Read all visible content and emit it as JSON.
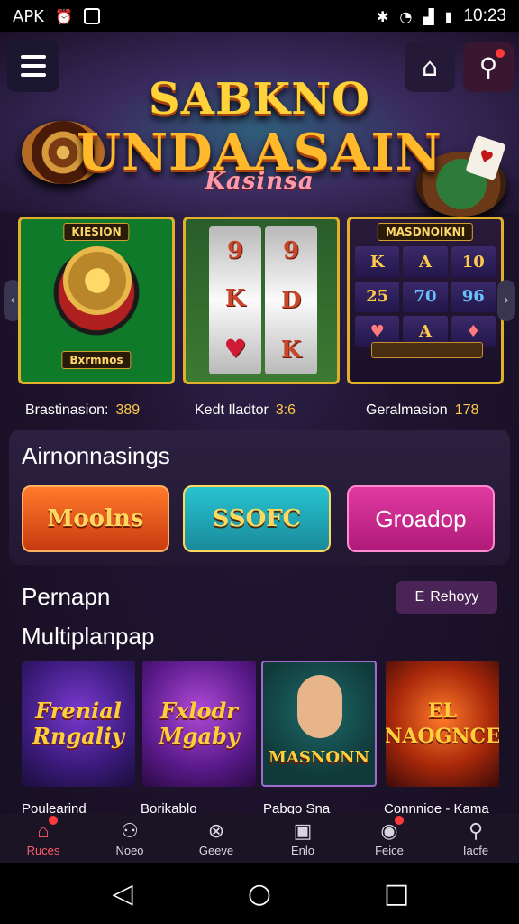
{
  "status_bar": {
    "carrier": "APK",
    "time": "10:23",
    "left_icons": [
      "alarm-icon",
      "image-icon"
    ],
    "right_icons": [
      "bluetooth-icon",
      "wifi-icon",
      "signal-icon",
      "battery-icon"
    ]
  },
  "header": {
    "logo_line1": "SABKNO",
    "logo_line2": "UNDAASAIN",
    "logo_line3": "Kasinsa",
    "menu_icon": "hamburger-menu-icon",
    "icon_buttons": [
      "profile-icon",
      "search-icon"
    ]
  },
  "carousel": {
    "cards": [
      {
        "banner_top": "KIESION",
        "banner_bottom": "Bxrmnos",
        "caption": "Brastinasion:",
        "number": "389"
      },
      {
        "caption": "Kedt Iladtor",
        "number": "3:6",
        "reels": [
          [
            "9",
            "K",
            "♥"
          ],
          [
            "9",
            "D",
            "K"
          ]
        ]
      },
      {
        "banner_top": "MASDNOIKNI",
        "caption": "Geralmasion",
        "number": "178",
        "grid": [
          "K",
          "A",
          "10",
          "25",
          "70",
          "96",
          "♥",
          "A",
          "♦"
        ]
      }
    ]
  },
  "announcements": {
    "title": "Airnonnasings",
    "buttons": [
      "Moolns",
      "SSOFC",
      "Groadop"
    ]
  },
  "popular": {
    "title1": "Pernapn",
    "title2": "Multiplanpap",
    "history_label": "Rehoyy",
    "history_prefix": "E",
    "tiles": [
      {
        "art_text": "Frenial Rngaliy",
        "caption": "Poulearind"
      },
      {
        "art_text": "Fxlodr Mgaby",
        "caption": "Borikablo"
      },
      {
        "art_text": "MASNONN",
        "caption": "Pabgo Sna"
      },
      {
        "art_text": "EL NAOGNCE",
        "caption": "Connnioe - Kama"
      }
    ]
  },
  "bottom_nav": {
    "items": [
      {
        "label": "Ruces",
        "icon": "home-icon",
        "active": true,
        "badge": true
      },
      {
        "label": "Noeo",
        "icon": "games-icon",
        "active": false,
        "badge": false
      },
      {
        "label": "Geeve",
        "icon": "casino-chip-icon",
        "active": false,
        "badge": false
      },
      {
        "label": "Enlo",
        "icon": "wallet-icon",
        "active": false,
        "badge": false
      },
      {
        "label": "Feice",
        "icon": "gift-icon",
        "active": false,
        "badge": true
      },
      {
        "label": "Iacfe",
        "icon": "search-icon",
        "active": false,
        "badge": false
      }
    ]
  },
  "system_nav": [
    "back-icon",
    "home-circle-icon",
    "recents-icon"
  ],
  "colors": {
    "accent_gold": "#ffd23a",
    "active_nav": "#ff5a6a",
    "badge_red": "#ff3a3a"
  }
}
